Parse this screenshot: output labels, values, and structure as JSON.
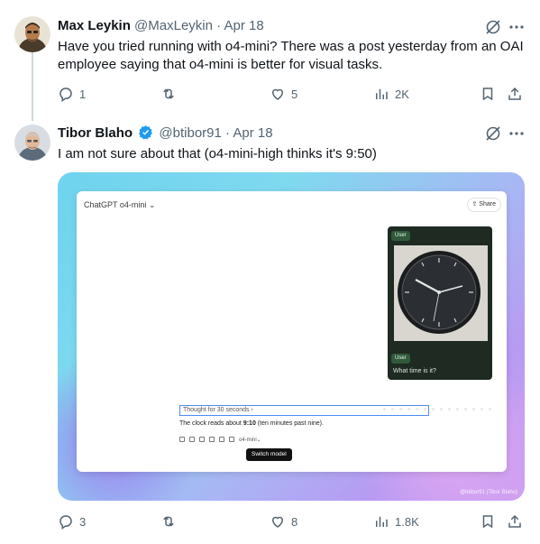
{
  "tweet1": {
    "name": "Max Leykin",
    "handle": "@MaxLeykin",
    "separator": "·",
    "date": "Apr 18",
    "text": "Have you tried running with o4-mini? There was a post yesterday from an OAI employee saying that o4-mini is better for visual tasks.",
    "replies": "1",
    "reposts": "",
    "likes": "5",
    "views": "2K"
  },
  "tweet2": {
    "name": "Tibor Blaho",
    "handle": "@btibor91",
    "separator": "·",
    "date": "Apr 18",
    "text": "I am not sure about that (o4-mini-high thinks it's 9:50)",
    "replies": "3",
    "reposts": "",
    "likes": "8",
    "views": "1.8K"
  },
  "screenshot": {
    "title": "ChatGPT o4-mini ⌄",
    "share": "⇪ Share",
    "user_badge": "User",
    "question": "What time is it?",
    "thought": "Thought for 30 seconds ›",
    "answer_prefix": "The clock reads about ",
    "answer_time": "9:10",
    "answer_suffix": " (ten minutes past nine).",
    "model_chip": "o4-mini⌄",
    "tooltip": "Switch model",
    "watermark": "@btibor91 (Tibor Blaho)"
  },
  "colors": {
    "verified": "#1d9bf0",
    "secondary_text": "#536471",
    "primary_text": "#0f1419"
  },
  "icons": [
    "reply-icon",
    "repost-icon",
    "like-icon",
    "views-icon",
    "bookmark-icon",
    "share-icon",
    "grok-icon",
    "more-icon",
    "verified-icon"
  ]
}
